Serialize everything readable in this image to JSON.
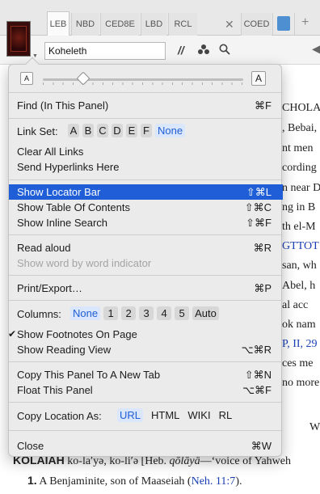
{
  "tabs": {
    "items": [
      {
        "label": "LEB"
      },
      {
        "label": "NBD"
      },
      {
        "label": "CED8E"
      },
      {
        "label": "LBD"
      },
      {
        "label": "RCL"
      },
      {
        "label": "COED"
      }
    ]
  },
  "toolbar": {
    "reference_value": "Koheleth"
  },
  "document": {
    "lines": [
      "CHOLA",
      ", Bebai,",
      "nt men",
      "cording",
      "n near D",
      "ng in B",
      "th el-M",
      "GTTOT",
      "san, wh",
      "Abel, h",
      "al acc",
      "ok nam",
      "P, II, 29",
      "ces me",
      "no more",
      "W"
    ],
    "entry_head": "KOLAIAH",
    "entry_pron": " ko-la′yə, ko-li′ə [Heb. ",
    "entry_heb": "qōlāyâ",
    "entry_tail": "—‘voice of Yahweh",
    "sense_num": "1.",
    "sense_text": " A Benjaminite, son of Maaseiah (",
    "sense_link": "Neh. 11:7",
    "sense_end": ")."
  },
  "menu": {
    "font_small": "A",
    "font_large": "A",
    "font_size_level": 0.2,
    "find": {
      "label": "Find (In This Panel)",
      "shortcut": "⌘F"
    },
    "link_set": {
      "label": "Link Set:",
      "options": [
        "A",
        "B",
        "C",
        "D",
        "E",
        "F"
      ],
      "selected": "None"
    },
    "clear_links": "Clear All Links",
    "send_hyperlinks": "Send Hyperlinks Here",
    "show_locator": {
      "label": "Show Locator Bar",
      "shortcut": "⇧⌘L"
    },
    "show_toc": {
      "label": "Show Table Of Contents",
      "shortcut": "⇧⌘C"
    },
    "show_inline_search": {
      "label": "Show Inline Search",
      "shortcut": "⇧⌘F"
    },
    "read_aloud": {
      "label": "Read aloud",
      "shortcut": "⌘R"
    },
    "show_word": "Show word by word indicator",
    "print_export": {
      "label": "Print/Export…",
      "shortcut": "⌘P"
    },
    "columns": {
      "label": "Columns:",
      "selected": "None",
      "options": [
        "1",
        "2",
        "3",
        "4",
        "5",
        "Auto"
      ]
    },
    "footnotes": {
      "label": "Show Footnotes On Page",
      "check": "✔"
    },
    "reading_view": {
      "label": "Show Reading View",
      "shortcut": "⌥⌘R"
    },
    "copy_panel": {
      "label": "Copy This Panel To A New Tab",
      "shortcut": "⇧⌘N"
    },
    "float_panel": {
      "label": "Float This Panel",
      "shortcut": "⌥⌘F"
    },
    "copy_location": {
      "label": "Copy Location As:",
      "selected": "URL",
      "options": [
        "HTML",
        "WIKI",
        "RL"
      ]
    },
    "close": {
      "label": "Close",
      "shortcut": "⌘W"
    }
  },
  "colors": {
    "highlight": "#1f5ed6",
    "link": "#1a3fb3",
    "chip_selected": "#d9e6fb"
  }
}
